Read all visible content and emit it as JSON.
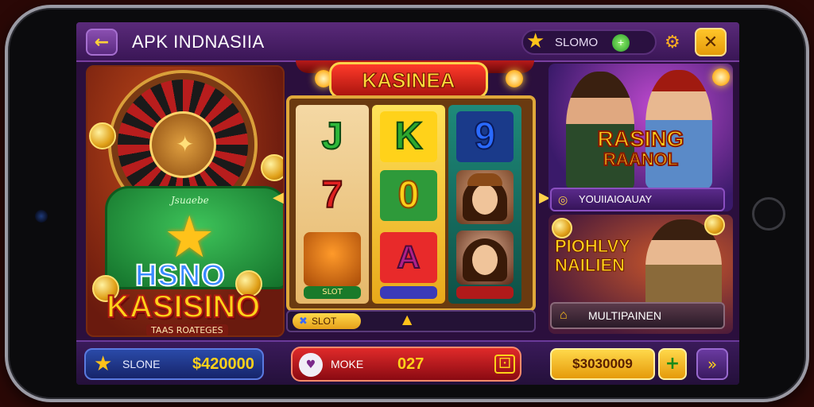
{
  "header": {
    "back_icon": "arrow-left-icon",
    "title": "APK INDNASIIA",
    "star_label": "SLOMO",
    "close_icon": "close-icon"
  },
  "left_panel": {
    "bag_label": "Jsuaebe",
    "logo_top": "HSNO",
    "logo_main": "KASISINO",
    "logo_sub": "TAAS ROATEGES"
  },
  "reels": {
    "title": "KASINEA",
    "symbols": {
      "reel1_top": "J",
      "reel1_mid": "7",
      "reel2_top": "K",
      "reel2_mid": "0",
      "reel2_bot": "A",
      "reel3_top": "9"
    },
    "tags": {
      "reel1": "SLOT"
    },
    "footer_button": "SLOT"
  },
  "promos": {
    "top_title": "RASING",
    "top_sub": "RAANOL",
    "top_bar": "YOUIIAIOAUAY",
    "bottom_title": "PIOHLVY NAILIEN",
    "bottom_bar": "MULTIPAINEN"
  },
  "bottom": {
    "balance_label": "SLONE",
    "balance_value": "$420000",
    "mid_label": "MOKE",
    "mid_value": "027",
    "jackpot": "$3030009",
    "plus_icon": "plus-icon",
    "next_icon": "chevron-right-icon"
  },
  "colors": {
    "accent_gold": "#ffc21a",
    "header_purple": "#3a1656",
    "reels_red": "#e02a2a"
  }
}
